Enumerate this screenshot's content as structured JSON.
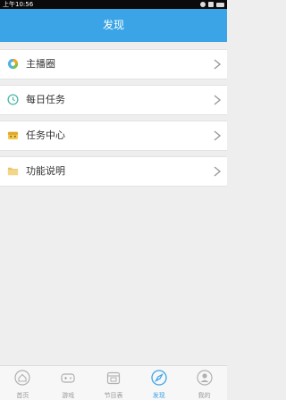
{
  "status_bar": {
    "time": "上午10:56"
  },
  "header": {
    "title": "发现"
  },
  "menu": {
    "items": [
      {
        "label": "主播圈",
        "icon": "color-ring-icon"
      },
      {
        "label": "每日任务",
        "icon": "clock-icon"
      },
      {
        "label": "任务中心",
        "icon": "treasure-chest-icon"
      },
      {
        "label": "功能说明",
        "icon": "folder-icon"
      }
    ]
  },
  "tabbar": {
    "tabs": [
      {
        "label": "首页",
        "icon": "home-icon",
        "active": false
      },
      {
        "label": "游戏",
        "icon": "gamepad-icon",
        "active": false
      },
      {
        "label": "节目表",
        "icon": "calendar-icon",
        "active": false
      },
      {
        "label": "发现",
        "icon": "compass-icon",
        "active": true
      },
      {
        "label": "我的",
        "icon": "user-icon",
        "active": false
      }
    ]
  },
  "colors": {
    "accent": "#3aa4e6",
    "background": "#eeeeee",
    "tab_inactive": "#9a9a9a"
  }
}
